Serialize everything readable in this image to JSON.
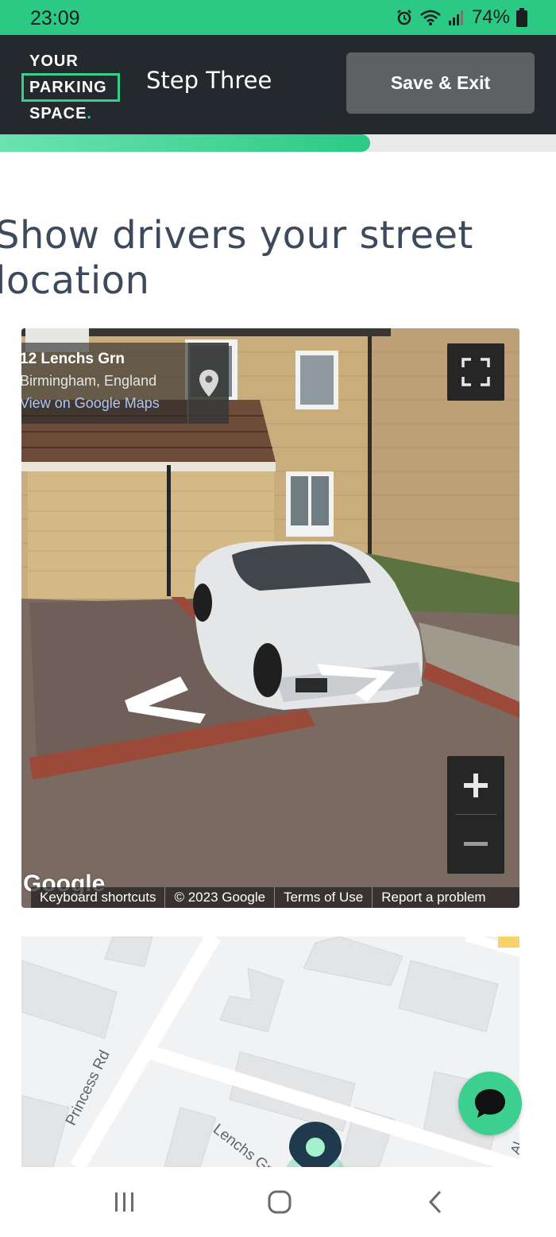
{
  "status_bar": {
    "time": "23:09",
    "battery": "74%",
    "icons": [
      "alarm-icon",
      "wifi-icon",
      "signal-icon",
      "battery-icon"
    ]
  },
  "header": {
    "logo": {
      "line1": "YOUR",
      "line2": "PARKING",
      "line3": "SPACE",
      "dot": "."
    },
    "step_title": "Step Three",
    "save_exit_label": "Save & Exit"
  },
  "progress": {
    "fraction": 0.666
  },
  "page": {
    "heading_line1": "Show drivers your street",
    "heading_line2": "location"
  },
  "street_view": {
    "address_title": "12 Lenchs Grn",
    "address_subtitle": "Birmingham, England",
    "view_link": "View on Google Maps",
    "google_logo": "Google",
    "footer": {
      "keyboard_shortcuts": "Keyboard shortcuts",
      "copyright": "© 2023 Google",
      "terms": "Terms of Use",
      "report": "Report a problem"
    },
    "icons": [
      "pin-icon",
      "fullscreen-icon",
      "zoom-in-icon",
      "zoom-out-icon",
      "nav-arrow-icon"
    ]
  },
  "map": {
    "roads": {
      "princess": "Princess Rd",
      "lenchs": "Lenchs Gr",
      "edge": "Al"
    }
  },
  "chat": {
    "icon": "chat-bubble-icon"
  },
  "nav_bar": {
    "icons": [
      "recents-icon",
      "home-icon",
      "back-icon"
    ]
  },
  "colors": {
    "accent": "#2cc985",
    "header_bg": "#24292d",
    "button_bg": "#5d6164",
    "heading": "#3d4a5c"
  }
}
